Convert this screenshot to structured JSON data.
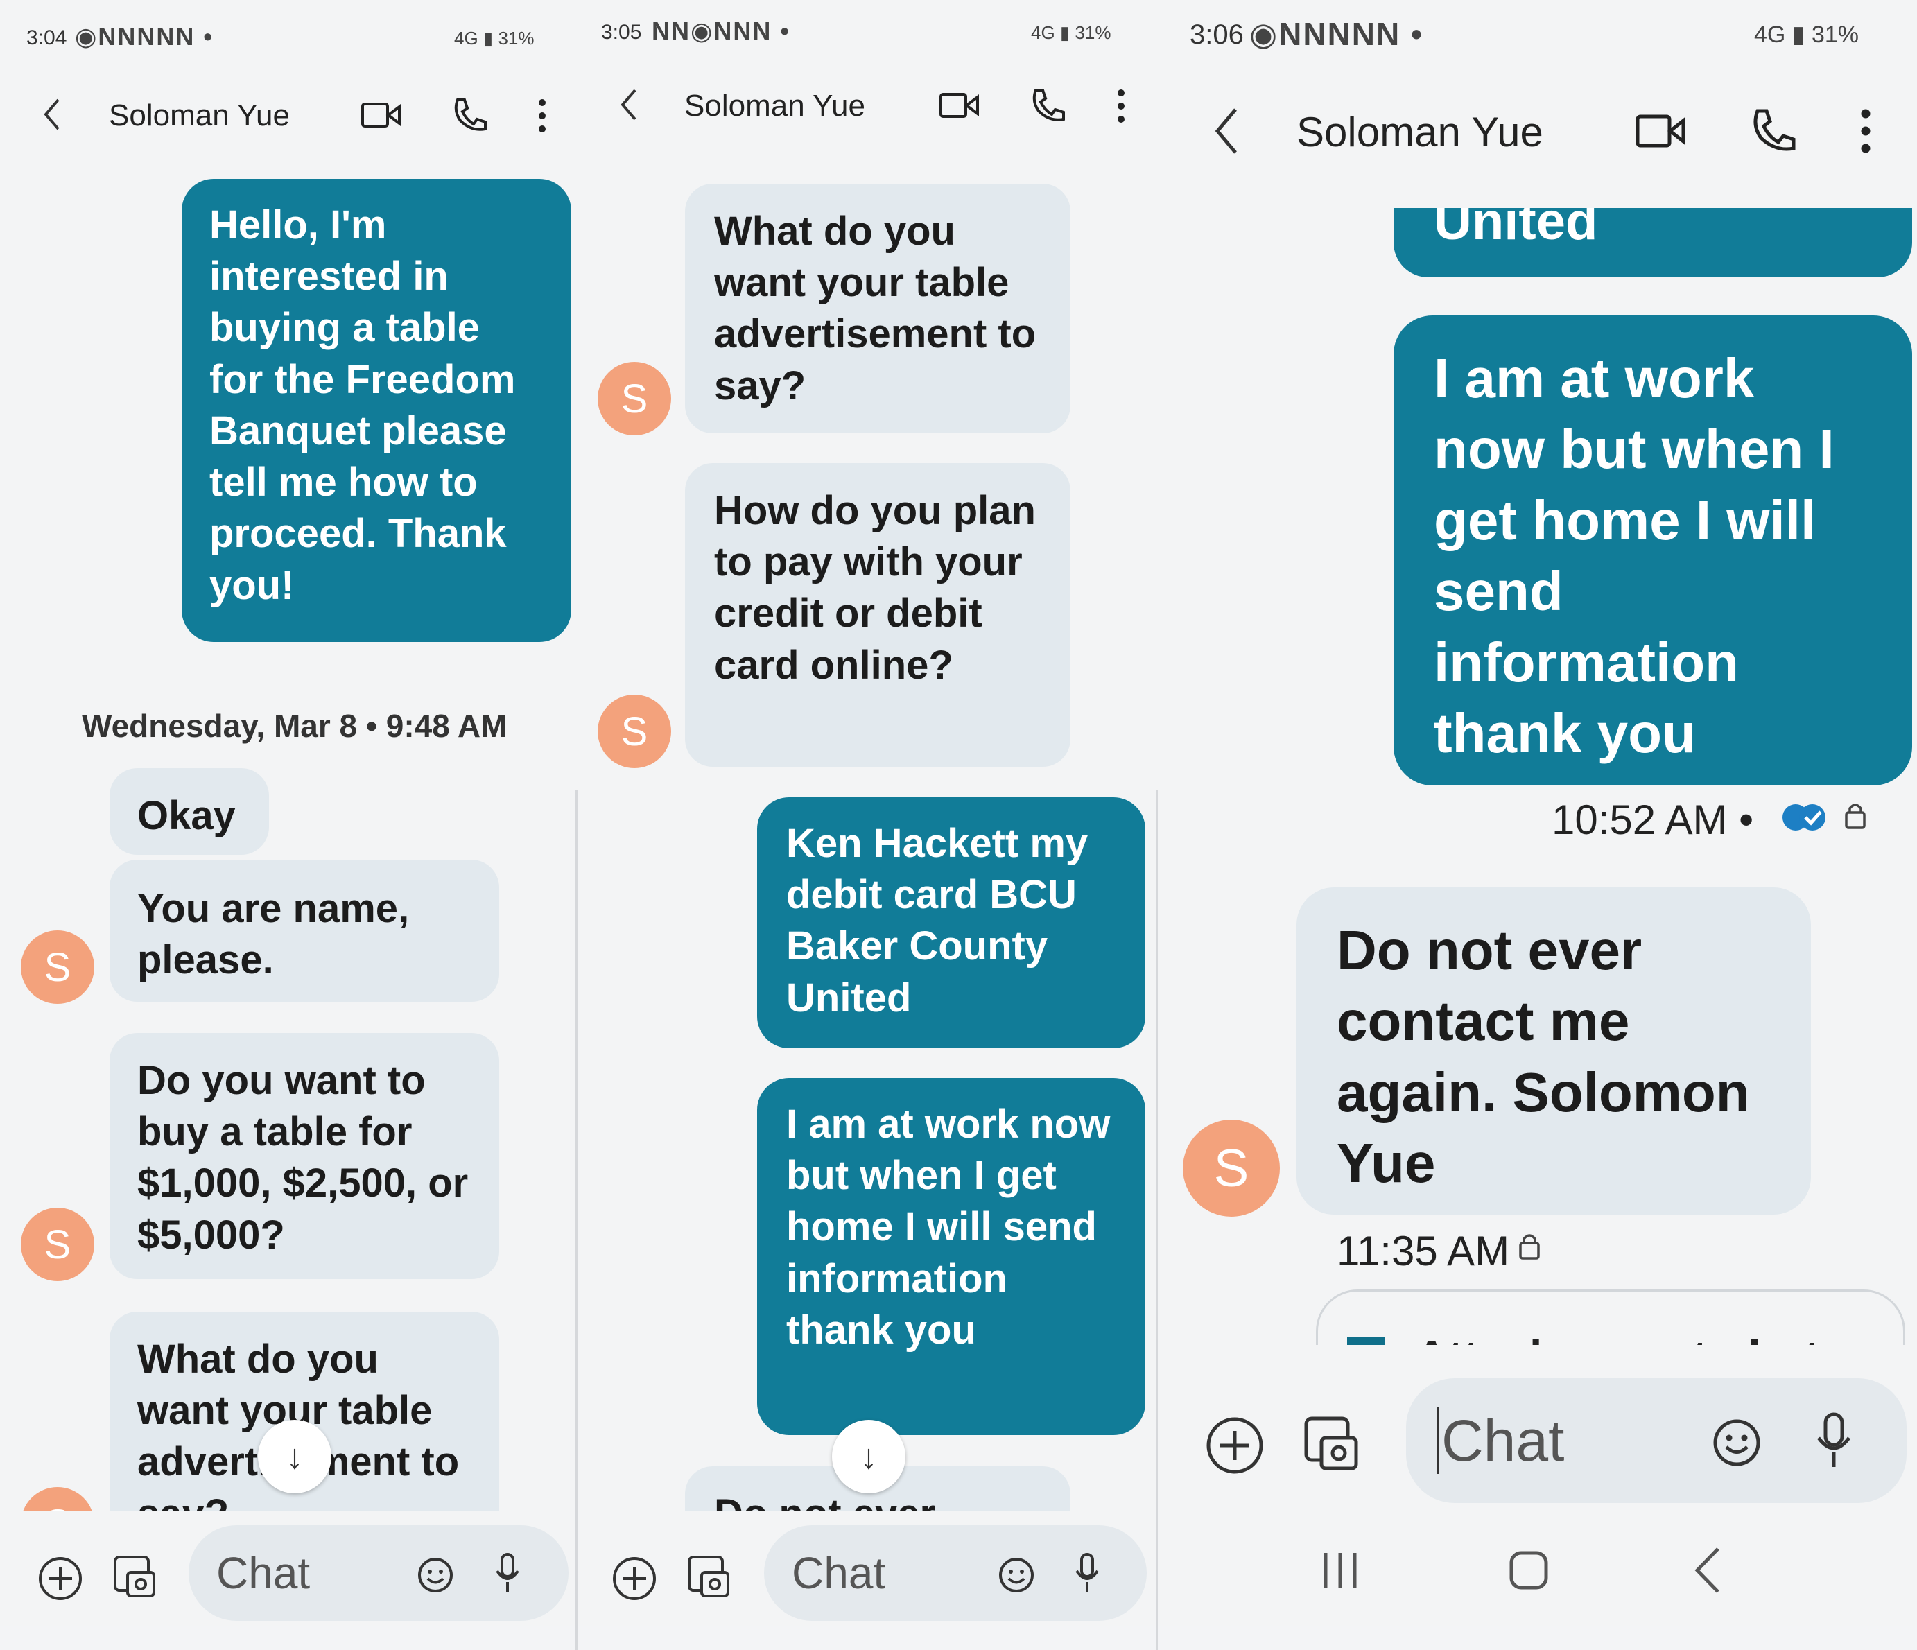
{
  "contact_name": "Soloman Yue",
  "avatar_letter": "S",
  "composer_placeholder": "Chat",
  "panels": [
    {
      "status_time": "3:04",
      "status_icons": "◉NNNNN •",
      "status_right": "4G ▮ 31%",
      "date_separator": "Wednesday, Mar 8 • 9:48 AM",
      "messages": [
        "Hello, I'm interested in buying  a table for the Freedom Banquet please tell me how to proceed. Thank you!",
        "Okay",
        "You are name, please.",
        "Do you want to buy a table for $1,000, $2,500, or $5,000?",
        "What do you want your table advertisement to say?"
      ]
    },
    {
      "status_time": "3:05",
      "status_icons": "NN◉NNN •",
      "status_right": "4G ▮ 31%",
      "messages": [
        "What do you want your table advertisement to say?",
        "How do you plan to pay with your credit or debit card online?",
        "Ken Hackett my debit card BCU Baker County United",
        "I am at work now but when I get home I will send information thank you",
        "Do not ever"
      ]
    },
    {
      "status_time": "3:06",
      "status_icons": "◉NNNNN •",
      "status_right": "4G ▮ 31%",
      "messages": [
        "United",
        "I am at work now but when I get home I will send information thank you",
        "Do not ever contact me again. Solomon Yue"
      ],
      "sent_time": "10:52 AM •",
      "received_time": "11:35 AM",
      "attach_suggestion": "Attach recent photo"
    }
  ],
  "colors": {
    "outgoing": "#117c98",
    "incoming": "#e2e9ee",
    "avatar": "#f3a27c",
    "background": "#f3f4f5"
  }
}
